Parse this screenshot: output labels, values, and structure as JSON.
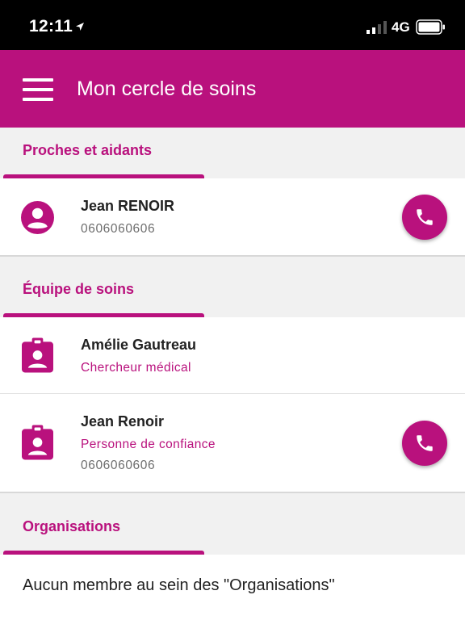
{
  "status_bar": {
    "time": "12:11",
    "network": "4G"
  },
  "app_bar": {
    "title": "Mon cercle de soins",
    "menu_icon": "hamburger-menu-icon"
  },
  "colors": {
    "accent": "#b9117d",
    "background": "#f1f1f1",
    "card": "#ffffff"
  },
  "sections": {
    "proches": {
      "title": "Proches et aidants",
      "contacts": [
        {
          "name": "Jean RENOIR",
          "phone": "0606060606",
          "icon": "person-avatar-icon"
        }
      ]
    },
    "equipe": {
      "title": "Équipe de soins",
      "contacts": [
        {
          "name": "Amélie Gautreau",
          "role": "Chercheur médical",
          "icon": "badge-icon"
        },
        {
          "name": "Jean Renoir",
          "role": "Personne de confiance",
          "phone": "0606060606",
          "icon": "badge-icon"
        }
      ]
    },
    "organisations": {
      "title": "Organisations",
      "empty_message": "Aucun membre au sein des \"Organisations\""
    }
  }
}
